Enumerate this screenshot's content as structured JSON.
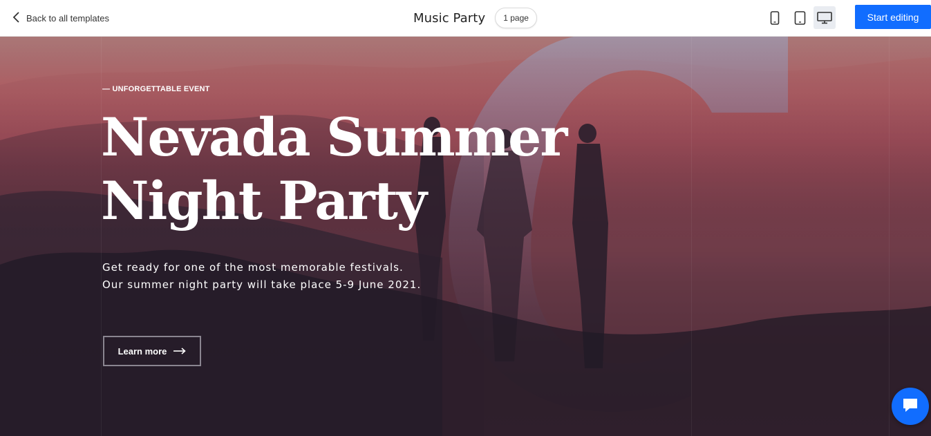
{
  "topbar": {
    "back_label": "Back to all templates",
    "site_title": "Music Party",
    "pages_badge": "1 page",
    "devices": [
      "mobile-icon",
      "tablet-icon",
      "desktop-icon"
    ],
    "active_device": "desktop",
    "start_label": "Start editing",
    "accent": "#116dff"
  },
  "hero": {
    "eyebrow": "— UNFORGETTABLE EVENT",
    "headline_line1": "Nevada Summer",
    "headline_line2": "Night Party",
    "sub_line1": "Get ready for one of the most memorable festivals.",
    "sub_line2": "Our summer night party will take place 5-9 June 2021.",
    "cta_label": "Learn more",
    "cta_icon": "arrow-right-icon"
  },
  "chat": {
    "icon": "chat-bubble-icon"
  }
}
